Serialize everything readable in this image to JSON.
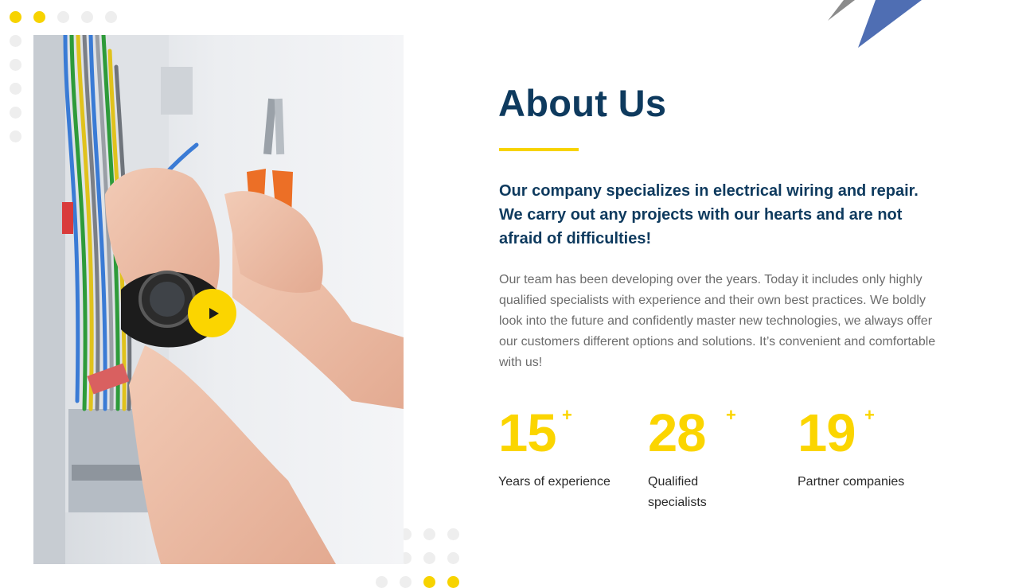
{
  "about": {
    "title": "About Us",
    "lead": "Our company specializes in electrical wiring and repair. We carry out any projects with our hearts and are not afraid of difficulties!",
    "body": "Our team has been developing over the years. Today it includes only highly qualified specialists with experience and their own best practices. We boldly look into the future and confidently master new technologies, we always offer our customers different options and solutions. It’s convenient and comfortable with us!"
  },
  "stats": [
    {
      "value": "15",
      "suffix": "+",
      "label": "Years of experience"
    },
    {
      "value": "28",
      "suffix": "+",
      "label": "Qualified specialists"
    },
    {
      "value": "19",
      "suffix": "+",
      "label": "Partner companies"
    }
  ],
  "media": {
    "play_icon": "play-icon"
  },
  "colors": {
    "accent": "#fbd500",
    "heading": "#0e3a5e",
    "body": "#6c6c6c"
  }
}
